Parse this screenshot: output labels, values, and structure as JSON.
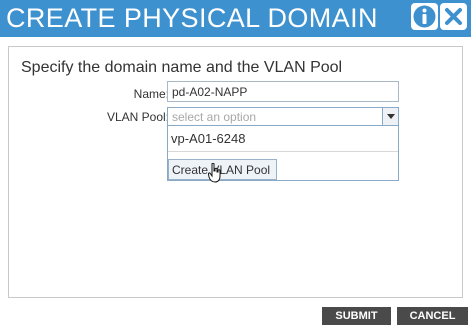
{
  "dialog": {
    "title": "CREATE PHYSICAL DOMAIN",
    "info_icon": "info-icon",
    "close_icon": "close-icon"
  },
  "form": {
    "instruction": "Specify the domain name and the VLAN Pool",
    "name_label": "Name:",
    "name_value": "pd-A02-NAPP",
    "vlan_pool_label": "VLAN Pool:",
    "vlan_pool_placeholder": "select an option",
    "vlan_pool_options": [
      "vp-A01-6248"
    ],
    "create_vlan_pool_label": "Create VLAN Pool"
  },
  "footer": {
    "submit_label": "SUBMIT",
    "cancel_label": "CANCEL"
  },
  "colors": {
    "title_bar": "#3e91cf",
    "footer_button": "#4a4a4a"
  }
}
